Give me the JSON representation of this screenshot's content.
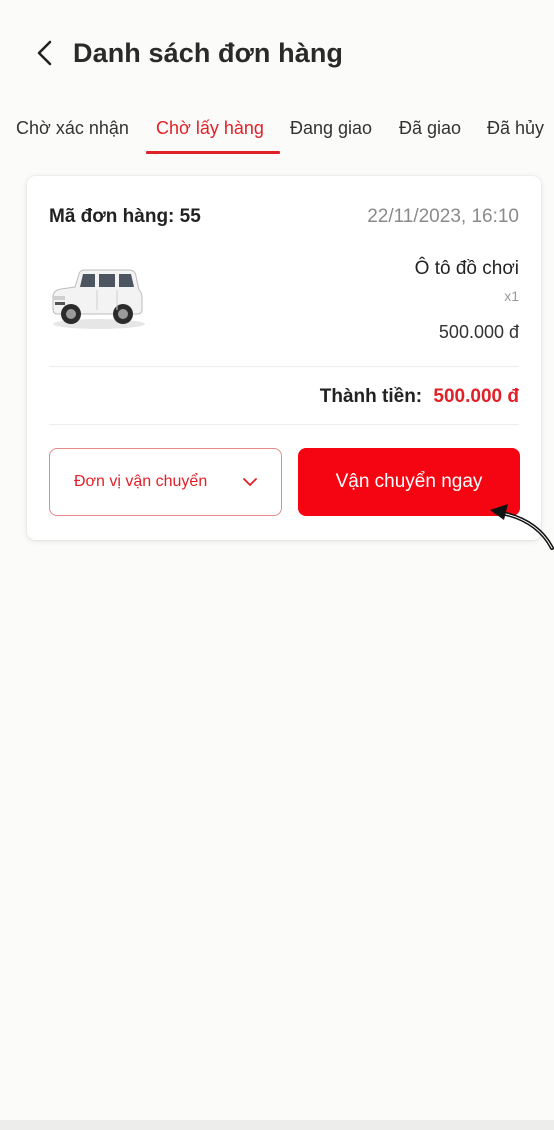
{
  "header": {
    "title": "Danh sách đơn hàng",
    "back_icon": "chevron-left-icon"
  },
  "tabs": [
    {
      "label": "Chờ xác nhận",
      "active": false
    },
    {
      "label": "Chờ lấy hàng",
      "active": true
    },
    {
      "label": "Đang giao",
      "active": false
    },
    {
      "label": "Đã giao",
      "active": false
    },
    {
      "label": "Đã hủy",
      "active": false
    }
  ],
  "order": {
    "code_label": "Mã đơn hàng: 55",
    "datetime": "22/11/2023, 16:10",
    "product": {
      "name": "Ô tô đồ chơi",
      "quantity": "x1",
      "price": "500.000 đ"
    },
    "total_label": "Thành tiền:",
    "total_value": "500.000 đ",
    "shipper_select": {
      "placeholder": "Đơn vị vận chuyển",
      "icon": "chevron-down-icon"
    },
    "ship_now_label": "Vận chuyển ngay"
  },
  "colors": {
    "accent": "#e02128",
    "button": "#f40511",
    "text_muted": "#8a8a8a"
  }
}
